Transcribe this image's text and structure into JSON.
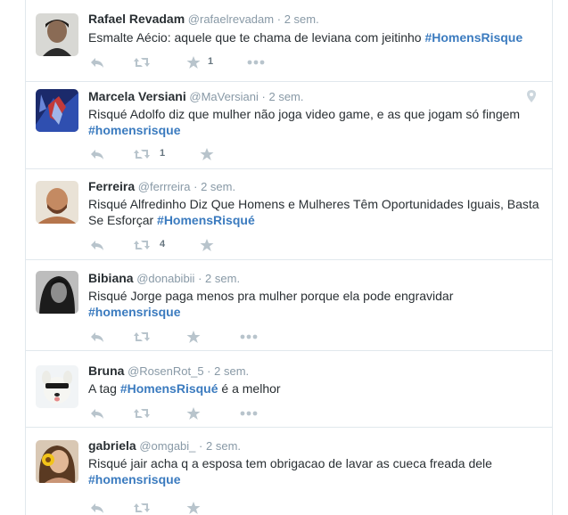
{
  "icons": {
    "reply": "reply-icon",
    "retweet": "retweet-icon",
    "favorite": "star-icon",
    "more": "more-icon",
    "location": "location-pin-icon"
  },
  "colors": {
    "hashtag": "#3b7bbf",
    "muted": "#8899a6",
    "action": "#b8c4cc",
    "border": "#e1e8ed"
  },
  "tweets": [
    {
      "fullname": "Rafael Revadam",
      "username": "@rafaelrevadam",
      "time": "2 sem.",
      "text_before": "Esmalte Aécio: aquele que te chama de leviana com jeitinho ",
      "hashtag": "#HomensRisque",
      "text_after": "",
      "retweets": "",
      "favorites": "1"
    },
    {
      "fullname": "Marcela Versiani",
      "username": "@MaVersiani",
      "time": "2 sem.",
      "text_before": "Risqué Adolfo diz que mulher não joga video game, e as que jogam só fingem ",
      "hashtag": "#homensrisque",
      "text_after": "",
      "retweets": "1",
      "favorites": ""
    },
    {
      "fullname": "Ferreira",
      "username": "@ferrreira",
      "time": "2 sem.",
      "text_before": "Risqué Alfredinho Diz Que Homens e Mulheres Têm Oportunidades Iguais, Basta Se Esforçar ",
      "hashtag": "#HomensRisqué",
      "text_after": "",
      "retweets": "4",
      "favorites": ""
    },
    {
      "fullname": "Bibiana",
      "username": "@donabibii",
      "time": "2 sem.",
      "text_before": "Risqué Jorge paga menos pra mulher porque ela pode engravidar ",
      "hashtag": "#homensrisque",
      "text_after": "",
      "retweets": "",
      "favorites": ""
    },
    {
      "fullname": "Bruna",
      "username": "@RosenRot_5",
      "time": "2 sem.",
      "text_before": "A tag ",
      "hashtag": "#HomensRisqué",
      "text_after": " é a melhor",
      "retweets": "",
      "favorites": ""
    },
    {
      "fullname": "gabriela",
      "username": "@omgabi_",
      "time": "2 sem.",
      "text_before": "Risqué jair acha q a esposa tem obrigacao de lavar as cueca freada dele ",
      "hashtag": "#homensrisque",
      "text_after": "",
      "retweets": "",
      "favorites": ""
    }
  ]
}
